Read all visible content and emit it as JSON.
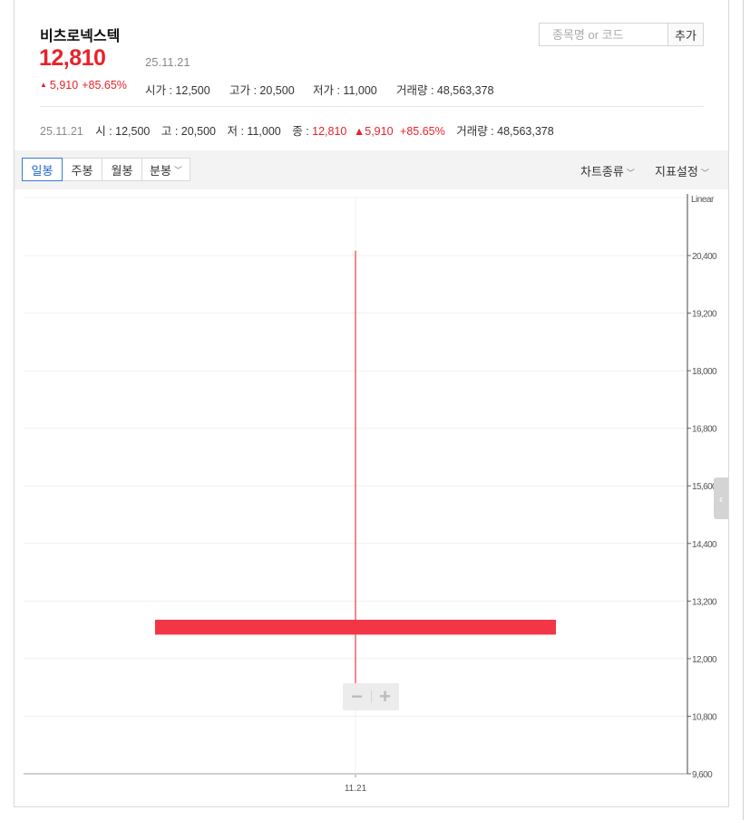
{
  "stock": {
    "name": "비츠로넥스텍",
    "price": "12,810",
    "date": "25.11.21",
    "change": "5,910",
    "change_rate": "+85.65%",
    "summary": [
      {
        "label": "시가 : 12,500"
      },
      {
        "label": "고가 : 20,500"
      },
      {
        "label": "저가 : 11,000"
      },
      {
        "label": "거래량 : 48,563,378"
      }
    ]
  },
  "search": {
    "placeholder": "종목명 or 코드",
    "add_label": "추가"
  },
  "ohlc": {
    "date": "25.11.21",
    "open": "시 : 12,500",
    "high": "고 : 20,500",
    "low": "저 : 11,000",
    "close_label": "종 :",
    "close_value": "12,810",
    "change": "5,910",
    "change_rate": "+85.65%",
    "volume": "거래량 : 48,563,378"
  },
  "toolbar": {
    "periods": [
      {
        "label": "일봉",
        "active": true
      },
      {
        "label": "주봉",
        "active": false
      },
      {
        "label": "월봉",
        "active": false
      },
      {
        "label": "분봉",
        "active": false,
        "dropdown": true
      }
    ],
    "chart_type": "차트종류",
    "indicator": "지표설정"
  },
  "colors": {
    "up": "#e8222b",
    "candle": "#f23645",
    "active_tab": "#1e64c8"
  },
  "icons": [
    "chevron-down-icon",
    "chevron-left-icon",
    "zoom-out-icon",
    "zoom-in-icon",
    "triangle-up-icon"
  ],
  "chart_data": {
    "type": "candlestick",
    "scale": "Linear",
    "x": [
      "11.21"
    ],
    "candles": [
      {
        "date": "11.21",
        "open": 12500,
        "high": 20500,
        "low": 11000,
        "close": 12810
      }
    ],
    "ylim": [
      9600,
      21600
    ],
    "yticks": [
      9600,
      10800,
      12000,
      13200,
      14400,
      15600,
      16800,
      18000,
      19200,
      20400
    ],
    "grid": true
  }
}
